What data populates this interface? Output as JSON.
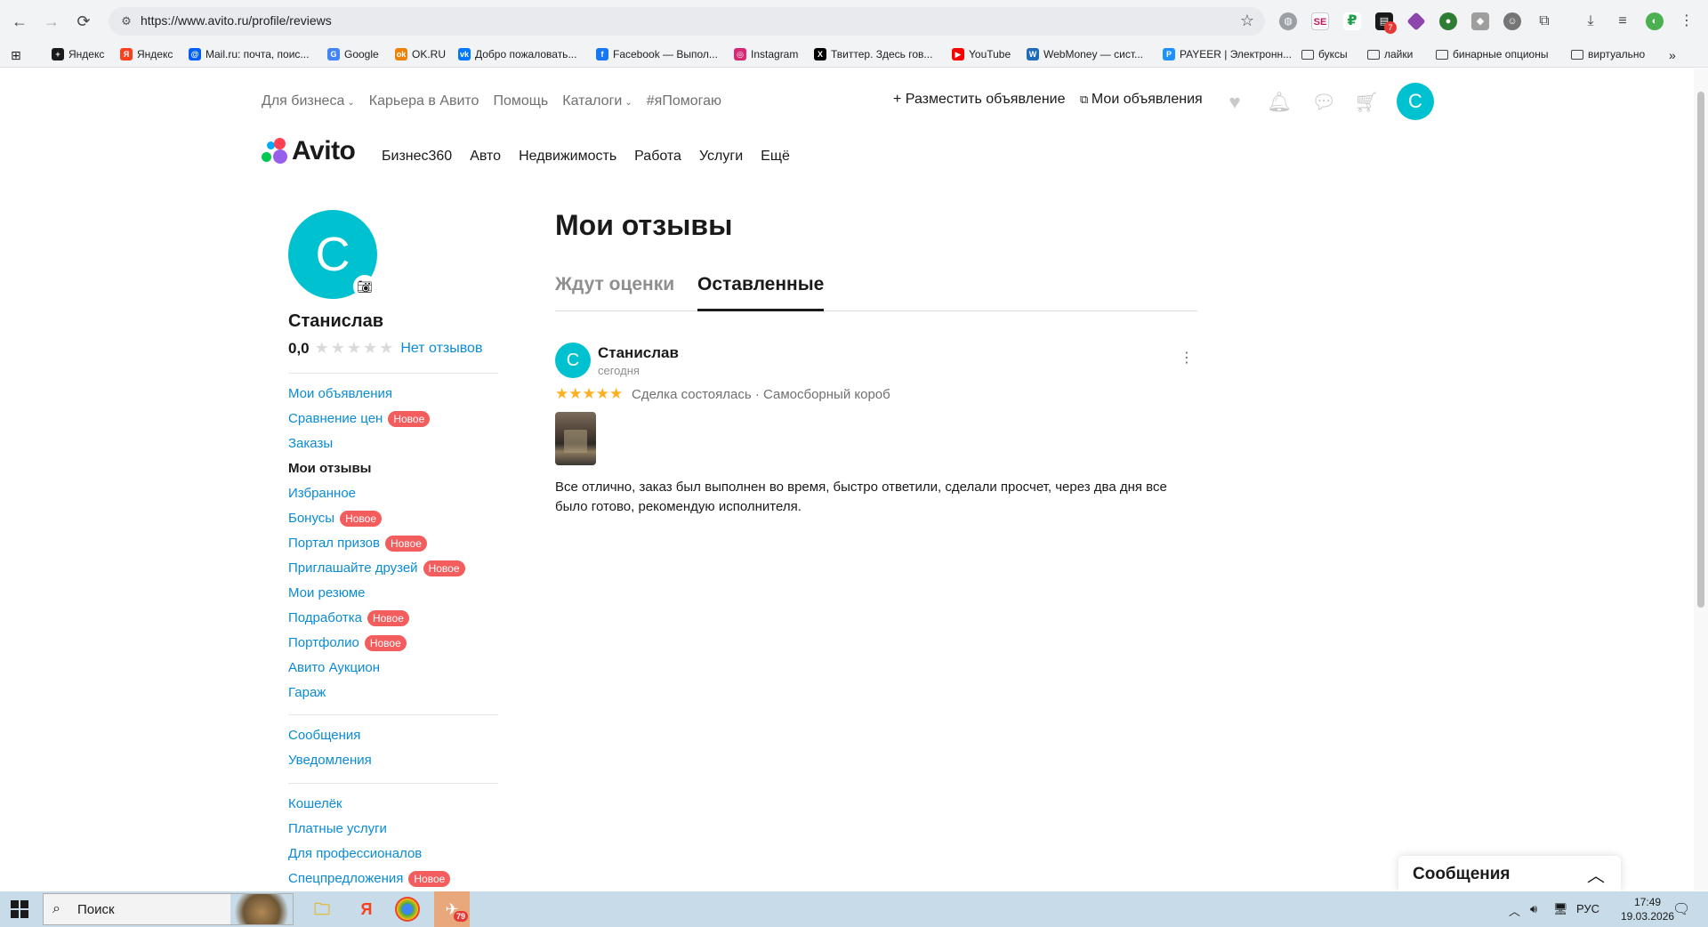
{
  "browser": {
    "url": "https://www.avito.ru/profile/reviews",
    "bookmarks": [
      {
        "label": "Яндекс",
        "color": "#1a1a1a",
        "glyph": "+"
      },
      {
        "label": "Яндекс",
        "color": "#fc3f1d",
        "glyph": "Я"
      },
      {
        "label": "Mail.ru: почта, поис...",
        "color": "#005ff9",
        "glyph": "@"
      },
      {
        "label": "Google",
        "color": "#4285f4",
        "glyph": "G"
      },
      {
        "label": "OK.RU",
        "color": "#ee8208",
        "glyph": "ok"
      },
      {
        "label": "Добро пожаловать...",
        "color": "#0077ff",
        "glyph": "vk"
      },
      {
        "label": "Facebook — Выпол...",
        "color": "#1877f2",
        "glyph": "f"
      },
      {
        "label": "Instagram",
        "color": "#d62976",
        "glyph": "◎"
      },
      {
        "label": "Твиттер. Здесь гов...",
        "color": "#000000",
        "glyph": "X"
      },
      {
        "label": "YouTube",
        "color": "#ff0000",
        "glyph": "▶"
      },
      {
        "label": "WebMoney — сист...",
        "color": "#1e6bb8",
        "glyph": "W"
      },
      {
        "label": "PAYEER | Электронн...",
        "color": "#1e90ff",
        "glyph": "P"
      },
      {
        "label": "буксы",
        "folder": true
      },
      {
        "label": "лайки",
        "folder": true
      },
      {
        "label": "бинарные опционы",
        "folder": true
      },
      {
        "label": "виртуально",
        "folder": true
      }
    ],
    "badge_count": "7"
  },
  "header": {
    "topnav": [
      "Для бизнеса",
      "Карьера в Авито",
      "Помощь",
      "Каталоги",
      "#яПомогаю"
    ],
    "post_ad": "Разместить объявление",
    "my_ads": "Мои объявления",
    "avatar_letter": "С",
    "logo_text": "Avito",
    "categories": [
      "Бизнес360",
      "Авто",
      "Недвижимость",
      "Работа",
      "Услуги",
      "Ещё"
    ]
  },
  "profile": {
    "avatar_letter": "С",
    "name": "Станислав",
    "rating": "0,0",
    "no_reviews": "Нет отзывов"
  },
  "sidebar": {
    "group1": [
      {
        "label": "Мои объявления"
      },
      {
        "label": "Сравнение цен",
        "badge": "Новое"
      },
      {
        "label": "Заказы"
      },
      {
        "label": "Мои отзывы",
        "active": true
      },
      {
        "label": "Избранное"
      },
      {
        "label": "Бонусы",
        "badge": "Новое"
      },
      {
        "label": "Портал призов",
        "badge": "Новое"
      },
      {
        "label": "Приглашайте друзей",
        "badge": "Новое"
      },
      {
        "label": "Мои резюме"
      },
      {
        "label": "Подработка",
        "badge": "Новое"
      },
      {
        "label": "Портфолио",
        "badge": "Новое"
      },
      {
        "label": "Авито Аукцион"
      },
      {
        "label": "Гараж"
      }
    ],
    "group2": [
      {
        "label": "Сообщения"
      },
      {
        "label": "Уведомления"
      }
    ],
    "group3": [
      {
        "label": "Кошелёк"
      },
      {
        "label": "Платные услуги"
      },
      {
        "label": "Для профессионалов"
      },
      {
        "label": "Спецпредложения",
        "badge": "Новое"
      }
    ]
  },
  "main": {
    "title": "Мои отзывы",
    "tabs": [
      {
        "label": "Ждут оценки",
        "active": false
      },
      {
        "label": "Оставленные",
        "active": true
      }
    ],
    "review": {
      "avatar_letter": "С",
      "author": "Станислав",
      "date": "сегодня",
      "stars": 5,
      "meta": "Сделка состоялась · Самосборный короб",
      "text": "Все отлично, заказ был выполнен во время, быстро ответили, сделали просчет, через два дня все было готово, рекомендую исполнителя."
    }
  },
  "messages_panel": {
    "title": "Сообщения"
  },
  "taskbar": {
    "search_text": "Поиск",
    "language": "РУС",
    "time": "17:49",
    "date": "19.03.2026",
    "telegram_badge": "79"
  },
  "colors": {
    "accent": "#0a8bd6",
    "avatar": "#00c1cf",
    "badge": "#f45d5d",
    "stars": "#ffb021"
  }
}
